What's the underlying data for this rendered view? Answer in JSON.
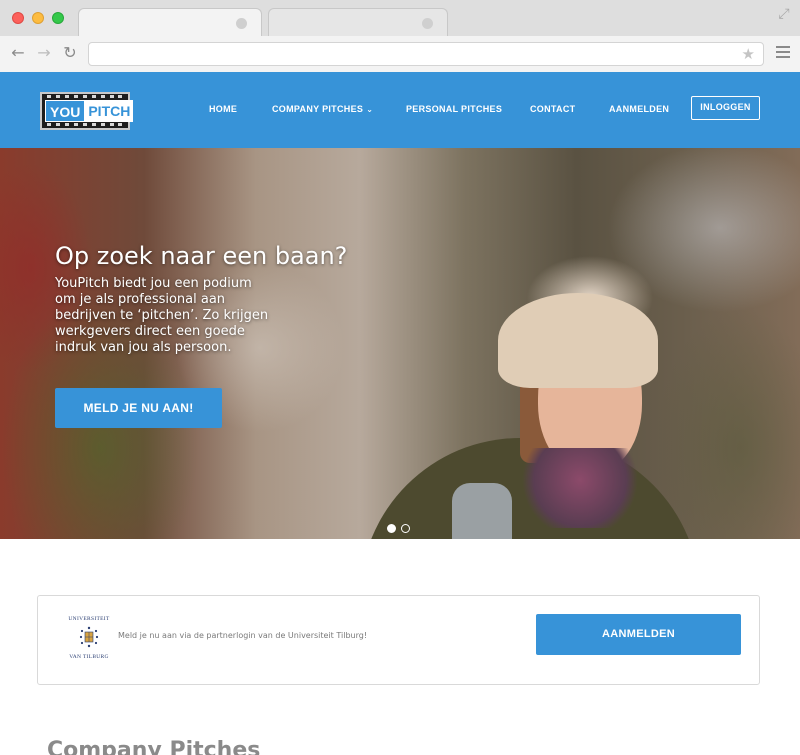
{
  "browser": {
    "active_tab_title": "",
    "url": "",
    "icons": {
      "back": "back-arrow-icon",
      "forward": "forward-arrow-icon",
      "reload": "reload-icon",
      "star": "star-icon",
      "menu": "hamburger-menu-icon",
      "fullscreen": "fullscreen-icon"
    }
  },
  "header": {
    "logo": {
      "part1": "YOU",
      "part2": "PITCH"
    },
    "nav": {
      "home": "HOME",
      "company": "COMPANY PITCHES",
      "personal": "PERSONAL PITCHES",
      "contact": "CONTACT",
      "aanmelden": "AANMELDEN",
      "login": "INLOGGEN"
    },
    "accent_color": "#3793d8"
  },
  "hero": {
    "title": "Op zoek naar een baan?",
    "body": "YouPitch biedt jou een podium om je als professional aan bedrijven te ‘pitchen’. Zo krijgen werkgevers direct een goede indruk van jou als persoon.",
    "cta": "MELD JE NU AAN!",
    "slides": 2,
    "active_slide": 1
  },
  "partner": {
    "logo_top": "UNIVERSITEIT",
    "logo_bottom": "VAN TILBURG",
    "text": "Meld je nu aan via de partnerlogin van de Universiteit Tilburg!",
    "button": "AANMELDEN"
  },
  "sections": {
    "company_title": "Company Pitches"
  }
}
